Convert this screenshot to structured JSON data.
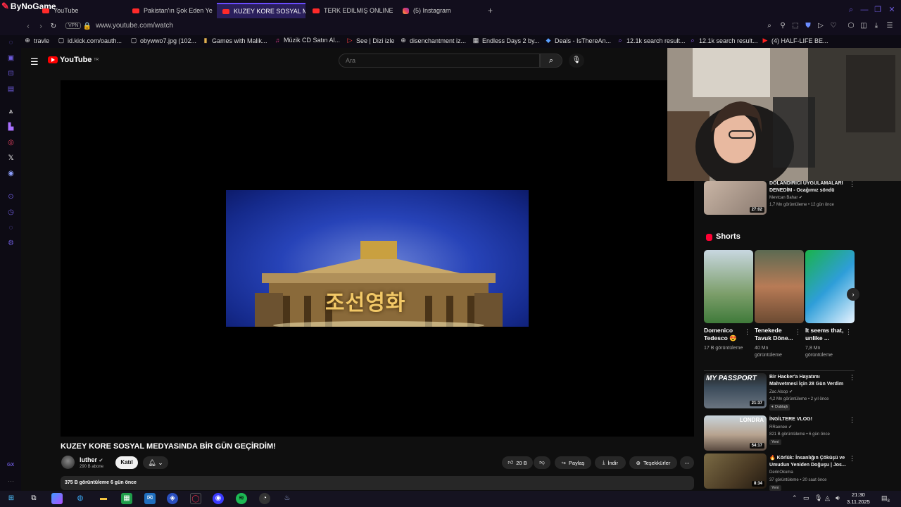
{
  "browser": {
    "brand": "ByNoGame",
    "tabs": [
      {
        "label": "YouTube"
      },
      {
        "label": "Pakistan'ın Şok Eden Yem"
      },
      {
        "label": "KUZEY KORE SOSYAL ME"
      },
      {
        "label": "TERK EDILMIŞ ONLINE O"
      },
      {
        "label": "(5) Instagram"
      }
    ],
    "new_tab": "+",
    "vpn": "VPN",
    "url": "www.youtube.com/watch",
    "bookmarks": [
      {
        "label": "travle",
        "icon": "globe-icon"
      },
      {
        "label": "id.kick.com/oauth...",
        "icon": "page-icon"
      },
      {
        "label": "obywwo7.jpg (102...",
        "icon": "page-icon"
      },
      {
        "label": "Games with Malik...",
        "icon": "bookmark-icon"
      },
      {
        "label": "Müzik CD Satın Al...",
        "icon": "music-icon"
      },
      {
        "label": "See | Dizi izle",
        "icon": "play-icon"
      },
      {
        "label": "disenchantment iz...",
        "icon": "globe-icon"
      },
      {
        "label": "Endless Days 2 by...",
        "icon": "image-icon"
      },
      {
        "label": "Deals - IsThereAn...",
        "icon": "tag-icon"
      },
      {
        "label": "12.1k search result...",
        "icon": "search-icon"
      },
      {
        "label": "12.1k search result...",
        "icon": "search-icon"
      },
      {
        "label": "(4) HALF-LIFE BE...",
        "icon": "youtube-icon"
      }
    ],
    "sidebar_bottom": "GX"
  },
  "youtube": {
    "logo": "YouTube",
    "region": "TR",
    "search_placeholder": "Ara",
    "video": {
      "frame_caption": "조선영화",
      "title": "KUZEY KORE SOSYAL MEDYASINDA BİR GÜN GEÇİRDİM!",
      "channel": "luther",
      "subscribers": "290 B abone",
      "join": "Katıl",
      "likes": "20 B",
      "share": "Paylaş",
      "download": "İndir",
      "thanks": "Teşekkürler",
      "description": "375 B görüntüleme  6 gün önce"
    },
    "recommended_top": {
      "title": "DOLANDIRICI UYGULAMALARI DENEDİM - Ocağımız söndü",
      "channel": "Mevtcan Bahar",
      "meta": "1,7 Mn görüntüleme • 12 gün önce",
      "duration": "27:02"
    },
    "shorts_heading": "Shorts",
    "shorts": [
      {
        "title": "Domenico Tedesco 😍",
        "views": "17 B görüntüleme"
      },
      {
        "title": "Tenekede Tavuk Döne...",
        "views": "40 Mn görüntüleme"
      },
      {
        "title": "It seems that, unlike ...",
        "views": "7,8 Mn görüntüleme"
      }
    ],
    "recommended": [
      {
        "title": "Bir Hacker'a Hayatımı Mahvetmesi İçin 28 Gün Verdim",
        "channel": "Zac Alsop",
        "meta": "4,2 Mn görüntüleme • 2 yıl önce",
        "badge": "Dublajlı",
        "duration": "21:37",
        "thumb_text": "MY PASSPORT"
      },
      {
        "title": "İNGİLTERE VLOG!",
        "channel": "RRaenee",
        "meta": "821 B görüntüleme • 6 gün önce",
        "badge": "Yeni",
        "duration": "54:17",
        "thumb_text": "LONDRA"
      },
      {
        "title": "🔥 Körlük: İnsanlığın Çöküşü ve Umudun Yeniden Doğuşu | Jos...",
        "channel": "DerinOkuma",
        "meta": "37 görüntüleme • 20 saat önce",
        "badge": "Yeni",
        "duration": "8:34",
        "thumb_text": ""
      }
    ]
  },
  "taskbar": {
    "time": "21:30",
    "date": "3.11.2025",
    "notifications": "8"
  }
}
